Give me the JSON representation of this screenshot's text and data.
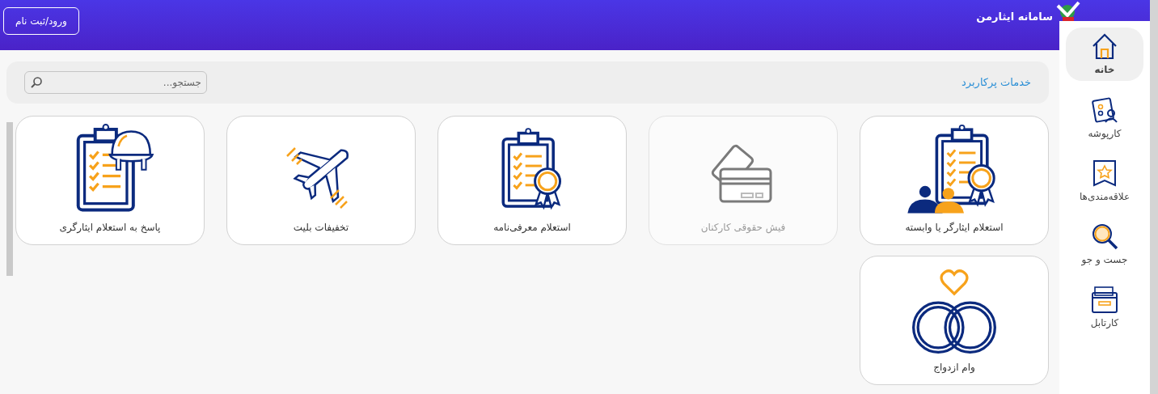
{
  "header": {
    "title": "سامانه ایثارمن",
    "login_button": "ورود/ثبت نام"
  },
  "sidebar": {
    "items": [
      {
        "label": "خانه",
        "kind": "home",
        "selected": true
      },
      {
        "label": "کارپوشه",
        "kind": "folder",
        "selected": false
      },
      {
        "label": "علاقه‌مندی‌ها",
        "kind": "favorites",
        "selected": false
      },
      {
        "label": "جست و جو",
        "kind": "search",
        "selected": false
      },
      {
        "label": "کارتابل",
        "kind": "cartable",
        "selected": false
      }
    ]
  },
  "services": {
    "title": "خدمات پرکاربرد",
    "search": {
      "placeholder": "جستجو..."
    },
    "cards": [
      {
        "label": "استعلام ایثارگر یا وابسته",
        "kind": "inquiry-people",
        "disabled": false
      },
      {
        "label": "فیش حقوقی کارکنان",
        "kind": "cards",
        "disabled": true
      },
      {
        "label": "استعلام معرفی‌نامه",
        "kind": "certificate",
        "disabled": false
      },
      {
        "label": "تخفیفات بلیت",
        "kind": "plane",
        "disabled": false
      },
      {
        "label": "پاسخ به استعلام ایثارگری",
        "kind": "helmet",
        "disabled": false
      },
      {
        "label": "وام ازدواج",
        "kind": "rings",
        "disabled": false
      }
    ]
  }
}
